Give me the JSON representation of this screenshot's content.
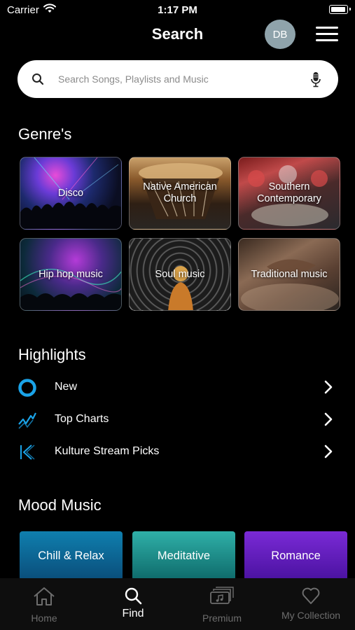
{
  "status_bar": {
    "carrier": "Carrier",
    "time": "1:17 PM"
  },
  "header": {
    "title": "Search",
    "avatar_initials": "DB"
  },
  "search": {
    "placeholder": "Search Songs, Playlists and Music"
  },
  "genres": {
    "title": "Genre's",
    "items": [
      {
        "label": "Disco"
      },
      {
        "label": "Native American Church"
      },
      {
        "label": "Southern Contemporary"
      },
      {
        "label": "Hip hop music"
      },
      {
        "label": "Soul music"
      },
      {
        "label": "Traditional music"
      }
    ]
  },
  "highlights": {
    "title": "Highlights",
    "items": [
      {
        "label": "New",
        "icon": "circle-ring-icon"
      },
      {
        "label": "Top Charts",
        "icon": "trend-chart-icon"
      },
      {
        "label": "Kulture Stream Picks",
        "icon": "kulture-logo-icon"
      }
    ]
  },
  "mood": {
    "title": "Mood Music",
    "items": [
      {
        "label": "Chill & Relax"
      },
      {
        "label": "Meditative"
      },
      {
        "label": "Romance"
      }
    ]
  },
  "tabs": [
    {
      "label": "Home",
      "icon": "home-icon",
      "active": false
    },
    {
      "label": "Find",
      "icon": "search-icon",
      "active": true
    },
    {
      "label": "Premium",
      "icon": "premium-icon",
      "active": false
    },
    {
      "label": "My Collection",
      "icon": "heart-icon",
      "active": false
    }
  ],
  "colors": {
    "accent": "#1aa3e8",
    "background": "#000000",
    "avatar": "#8fa3ab"
  }
}
